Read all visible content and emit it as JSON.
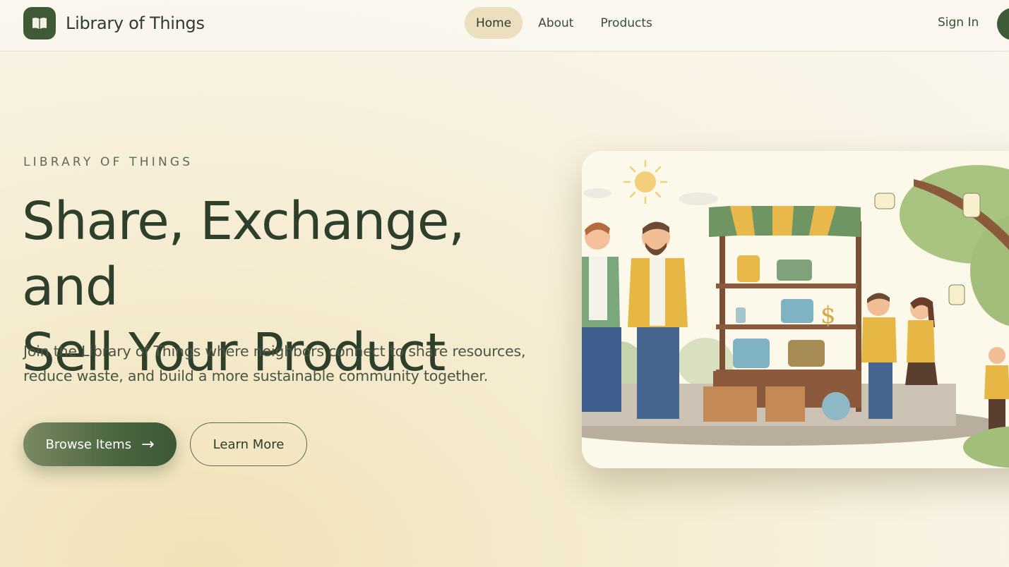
{
  "brand": {
    "name": "Library of Things",
    "logo_icon": "book-icon"
  },
  "nav": {
    "items": [
      {
        "label": "Home",
        "active": true
      },
      {
        "label": "About",
        "active": false
      },
      {
        "label": "Products",
        "active": false
      }
    ],
    "sign_in": "Sign In"
  },
  "hero": {
    "eyebrow": "LIBRARY OF THINGS",
    "headline_line1": "Share, Exchange, and",
    "headline_line2": "Sell Your Product",
    "description_line1": "Join the Library of Things where neighbors connect to share resources,",
    "description_line2": "reduce waste, and build a more sustainable community together.",
    "primary_button": "Browse Items",
    "secondary_button": "Learn More",
    "illustration_alt": "community-exchange-market-illustration"
  },
  "colors": {
    "brand_green": "#3e5a36",
    "active_nav_bg": "#ebdfbe",
    "text_dark": "#2e3f2b",
    "awning_yellow": "#e8b94a",
    "awning_green": "#6e9562"
  }
}
